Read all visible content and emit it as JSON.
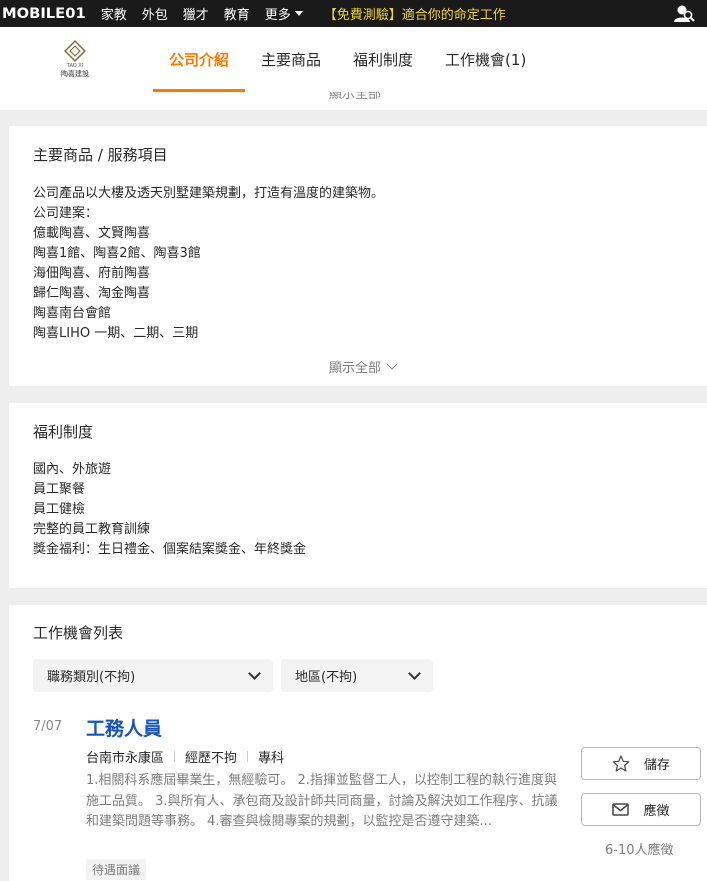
{
  "topbar": {
    "logo_text": "MOBILE01",
    "links": [
      "家教",
      "外包",
      "獵才",
      "教育"
    ],
    "more_label": "更多",
    "promo": "【免費測驗】適合你的命定工作"
  },
  "company": {
    "logo_sub": "陶喜建設",
    "logo_tiny": "TAO XI"
  },
  "tabs": [
    "公司介紹",
    "主要商品",
    "福利制度",
    "工作機會(1)"
  ],
  "partial_show_all": "顯示全部",
  "products": {
    "title": "主要商品 / 服務項目",
    "lines": [
      "公司產品以大樓及透天別墅建築規劃，打造有溫度的建築物。",
      "公司建案：",
      "億載陶喜、文賢陶喜",
      "陶喜1館、陶喜2館、陶喜3館",
      "海佃陶喜、府前陶喜",
      "歸仁陶喜、淘金陶喜",
      "陶喜南台會館",
      "陶喜LIHO 一期、二期、三期"
    ],
    "show_all": "顯示全部"
  },
  "benefits": {
    "title": "福利制度",
    "lines": [
      "國內、外旅遊",
      "員工聚餐",
      "員工健檢",
      "完整的員工教育訓練",
      "獎金福利：生日禮金、個案結案獎金、年終獎金"
    ]
  },
  "jobs": {
    "title": "工作機會列表",
    "filter_category": "職務類別(不拘)",
    "filter_area": "地區(不拘)",
    "item": {
      "date": "7/07",
      "title": "工務人員",
      "location": "台南市永康區",
      "experience": "經歷不拘",
      "education": "專科",
      "description": "1.相關科系應屆畢業生，無經驗可。 2.指揮並監督工人，以控制工程的執行進度與施工品質。 3.與所有人、承包商及設計師共同商量，討論及解決如工作程序、抗議和建築問題等事務。 4.審查與檢閱專案的規劃，以監控是否遵守建築...",
      "tag": "待遇面議",
      "save_label": "儲存",
      "apply_label": "應徵",
      "apply_count": "6-10人應徵"
    }
  }
}
